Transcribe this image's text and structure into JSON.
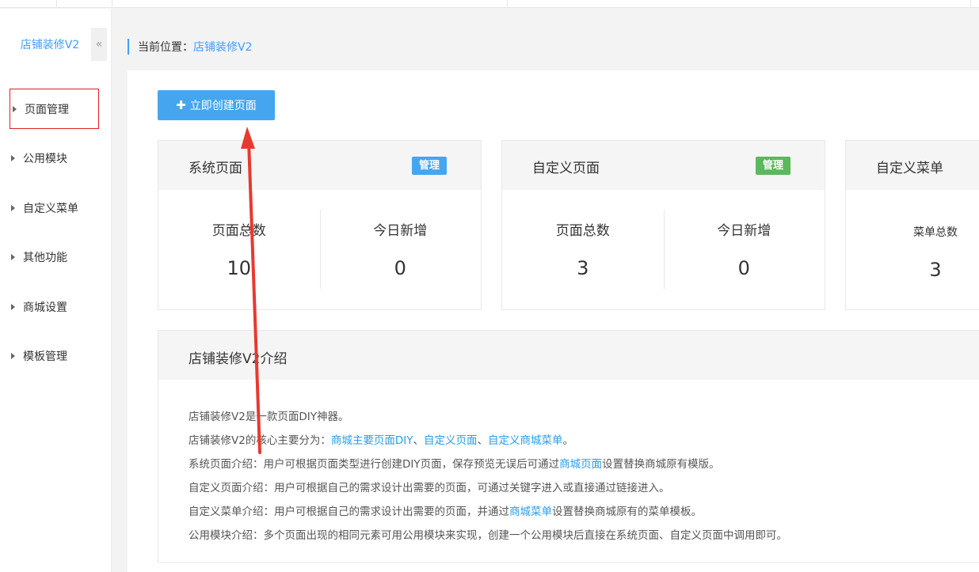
{
  "sidebar": {
    "title": "店铺装修V2",
    "collapse_icon": "«",
    "items": [
      {
        "label": "页面管理"
      },
      {
        "label": "公用模块"
      },
      {
        "label": "自定义菜单"
      },
      {
        "label": "其他功能"
      },
      {
        "label": "商城设置"
      },
      {
        "label": "模板管理"
      }
    ]
  },
  "breadcrumb": {
    "prefix": "当前位置：",
    "current": "店铺装修V2"
  },
  "create_button": {
    "icon": "✚",
    "label": "立即创建页面"
  },
  "cards": [
    {
      "title": "系统页面",
      "badge": "管理",
      "badge_color": "#45a6ef",
      "stats": [
        {
          "label": "页面总数",
          "value": "10"
        },
        {
          "label": "今日新增",
          "value": "0"
        }
      ]
    },
    {
      "title": "自定义页面",
      "badge": "管理",
      "badge_color": "#5cb85c",
      "stats": [
        {
          "label": "页面总数",
          "value": "3"
        },
        {
          "label": "今日新增",
          "value": "0"
        }
      ]
    },
    {
      "title": "自定义菜单",
      "stats": [
        {
          "label": "菜单总数",
          "value": "3"
        }
      ]
    }
  ],
  "intro": {
    "title": "店铺装修V2介绍",
    "lines": [
      {
        "segments": [
          "店铺装修V2是一款页面DIY神器。"
        ]
      },
      {
        "segments": [
          "店铺装修V2的核心主要分为：",
          "商城主要页面DIY",
          "、",
          "自定义页面",
          "、",
          "自定义商城菜单",
          "。"
        ]
      },
      {
        "segments": [
          "系统页面介绍：用户可根据页面类型进行创建DIY页面，保存预览无误后可通过",
          "商城页面",
          "设置替换商城原有模版。"
        ]
      },
      {
        "segments": [
          "自定义页面介绍：用户可根据自己的需求设计出需要的页面，可通过关键字进入或直接通过链接进入。"
        ]
      },
      {
        "segments": [
          "自定义菜单介绍：用户可根据自己的需求设计出需要的页面，并通过",
          "商城菜单",
          "设置替换商城原有的菜单模板。"
        ]
      },
      {
        "segments": [
          "公用模块介绍：多个页面出现的相同元素可用公用模块来实现，创建一个公用模块后直接在系统页面、自定义页面中调用即可。"
        ]
      }
    ]
  },
  "colors": {
    "accent": "#409eff",
    "link": "#2a9de8",
    "annotation": "#e8392f"
  }
}
